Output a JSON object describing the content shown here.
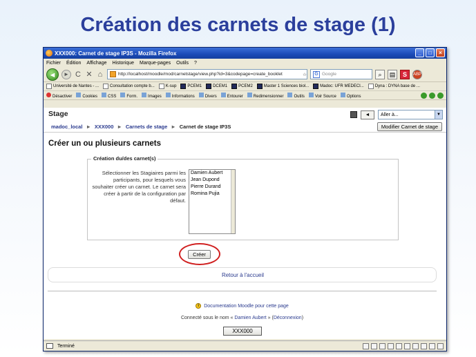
{
  "slide": {
    "title": "Création des carnets de stage (1)"
  },
  "window": {
    "title": "XXX000: Carnet de stage IP3S - Mozilla Firefox",
    "controls": [
      "_",
      "□",
      "×"
    ]
  },
  "menu": [
    "Fichier",
    "Édition",
    "Affichage",
    "Historique",
    "Marque-pages",
    "Outils",
    "?"
  ],
  "nav": {
    "url": "http://localhost/moodle/mod/carnetstage/view.php?id=3&codepage=create_booklet",
    "search_placeholder": "Google",
    "reload": "C",
    "stop": "✕",
    "home": "⌂"
  },
  "bookmarks": [
    "Université de Nantes - ...",
    "Consultation compte b...",
    "K-sup",
    "PCEM1",
    "DCEM1",
    "PCEM2",
    "Master 1 Sciences biol...",
    "Madoc: UFR MEDECI...",
    "Dyna : DYNA base de ..."
  ],
  "devtools": [
    "Désactiver",
    "Cookies",
    "CSS",
    "Form.",
    "Images",
    "Informations",
    "Divers",
    "Entourer",
    "Redimensionner",
    "Outils",
    "Voir Source",
    "Options"
  ],
  "page": {
    "header_title": "Stage",
    "jump_to": "Aller à...",
    "prev_arrow": "◄",
    "breadcrumb": [
      "madoc_local",
      "XXX000",
      "Carnets de stage",
      "Carnet de stage IP3S"
    ],
    "modify_button": "Modifier Carnet de stage",
    "section_title": "Créer un ou plusieurs carnets",
    "fieldset_legend": "Création du/des carnet(s)",
    "instructions": "Sélectionner les Stagiaires parmi les participants, pour lesquels vous souhaiter créer un carnet. Le carnet sera créer à partir de la configuration par défaut.",
    "participants": [
      "Damien Aubert",
      "Jean Dupond",
      "Pierre Durand",
      "Romina Pujia"
    ],
    "create_button": "Créer",
    "return_link": "Retour à l'accueil",
    "doc_link": "Documentation Moodle pour cette page",
    "logged_prefix": "Connecté sous le nom «",
    "logged_user": "Damien Aubert",
    "logged_mid": "» (",
    "logout": "Déconnexion",
    "logged_suffix": ")",
    "home_button": "XXX000"
  },
  "status": {
    "text": "Terminé"
  },
  "colors": {
    "slide_title": "#2b3f9c",
    "link": "#2a3a8e",
    "highlight_ring": "#d02020",
    "titlebar": "#1b4bb8"
  }
}
